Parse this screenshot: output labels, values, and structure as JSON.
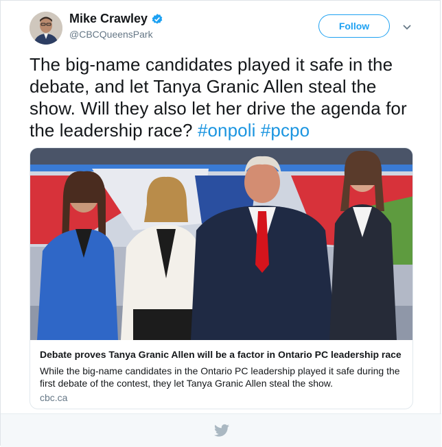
{
  "author": {
    "display_name": "Mike Crawley",
    "handle": "@CBCQueensPark",
    "verified": true
  },
  "actions": {
    "follow_label": "Follow",
    "menu_icon": "chevron-down-icon"
  },
  "tweet": {
    "text": "The big-name candidates played it safe in the debate, and let Tanya Granic Allen steal the show. Will they also let her drive the agenda for the leadership race?",
    "hashtags": [
      "#onpoli",
      "#pcpo"
    ]
  },
  "card": {
    "title": "Debate proves Tanya Granic Allen will be a factor in Ontario PC leadership race",
    "description": "While the big-name candidates in the Ontario PC leadership played it safe during the first debate of the contest, they let Tanya Granic Allen steal the show.",
    "domain": "cbc.ca"
  },
  "footer": {
    "icon": "twitter-bird-icon"
  },
  "colors": {
    "accent": "#1da1f2",
    "hashtag": "#1b95e0",
    "text": "#14171a",
    "muted": "#657786"
  }
}
